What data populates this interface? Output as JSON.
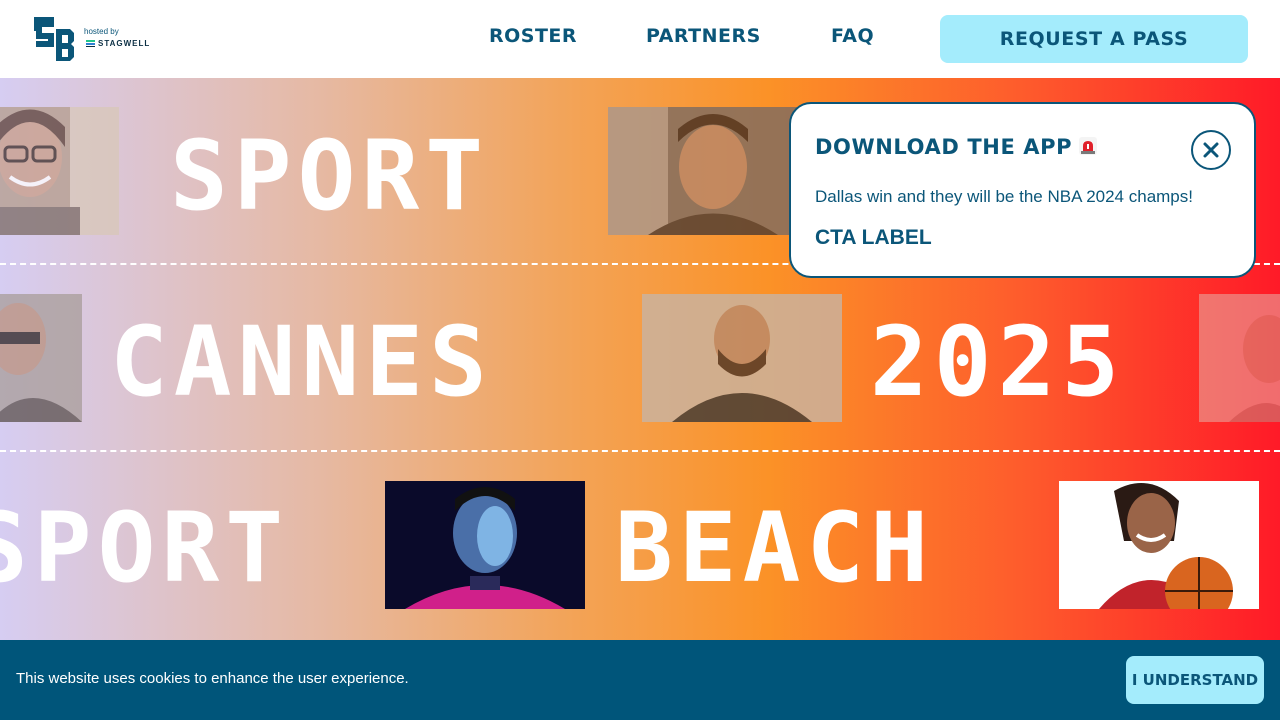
{
  "header": {
    "logo_icon": "sb-logo-icon",
    "hosted_by": "hosted by",
    "host_brand": "STAGWELL",
    "nav": [
      {
        "label": "ROSTER"
      },
      {
        "label": "PARTNERS"
      },
      {
        "label": "FAQ"
      }
    ],
    "cta_label": "REQUEST A PASS"
  },
  "hero": {
    "rows": [
      {
        "words": [
          "SPORT"
        ]
      },
      {
        "words": [
          "CANNES",
          "2025"
        ]
      },
      {
        "words": [
          "SPORT",
          "BEACH"
        ]
      }
    ],
    "photos": [
      "person-photo",
      "person-photo",
      "person-photo",
      "person-photo",
      "person-photo",
      "racing-driver-photo",
      "basketball-player-photo"
    ]
  },
  "popup": {
    "title": "DOWNLOAD THE APP",
    "title_icon": "siren-icon",
    "body": "Dallas win and they will be the NBA 2024 champs!",
    "cta_label": "CTA LABEL",
    "close_icon": "close-icon"
  },
  "cookie": {
    "text": "This website uses cookies to enhance the user experience.",
    "button_label": "I UNDERSTAND"
  },
  "colors": {
    "primary": "#0b5679",
    "accent": "#a4ecfc",
    "cookie_bg": "#00557a"
  }
}
